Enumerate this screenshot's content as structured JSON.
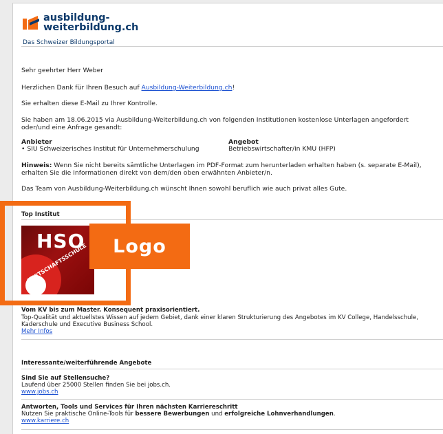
{
  "brand": {
    "line1": "ausbildung-",
    "line2": "weiterbildung.ch",
    "tagline": "Das Schweizer Bildungsportal",
    "colors": {
      "orange": "#f36b13",
      "navy": "#0d3a6b",
      "link": "#1a4fd0"
    }
  },
  "mail": {
    "salutation": "Sehr geehrter Herr Weber",
    "thanks_pre": "Herzlichen Dank für Ihren Besuch auf ",
    "thanks_link": "Ausbildung-Weiterbildung.ch",
    "thanks_post": "!",
    "control": "Sie erhalten diese E-Mail zu Ihrer Kontrolle.",
    "intro_line1": "Sie haben am 18.06.2015 via Ausbildung-Weiterbildung.ch von folgenden Institutionen kostenlose Unterlagen angefordert",
    "intro_line2": "oder/und eine Anfrage gesandt:",
    "anbieter_head": "Anbieter",
    "angebot_head": "Angebot",
    "anbieter_value": "• SIU Schweizerisches Institut für Unternehmerschulung",
    "angebot_value": "Betriebswirtschafter/in KMU (HFP)",
    "hinweis_label": "Hinweis:",
    "hinweis_line1": " Wenn Sie nicht bereits sämtliche Unterlagen im PDF-Format zum herunterladen erhalten haben (s. separate E-Mail),",
    "hinweis_line2": "erhalten Sie die Informationen direkt von dem/den oben erwähnten Anbieter/n.",
    "team": "Das Team von Ausbildung-Weiterbildung.ch wünscht Ihnen sowohl beruflich wie auch privat alles Gute."
  },
  "top_institut": {
    "heading": "Top Institut",
    "image_text": "HSO",
    "image_ring_text": "WIRTSCHAFTSSCHULE",
    "title": "Vom KV bis zum Master. Konsequent praxisorientiert.",
    "desc_line1": "Top-Qualität und aktuellstes Wissen auf jedem Gebiet, dank einer klaren Strukturierung des Angebotes im KV College, Handelsschule,",
    "desc_line2": "Kaderschule und Executive Business School.",
    "link": "Mehr Infos"
  },
  "overlay": {
    "label": "Logo"
  },
  "offers": {
    "heading": "Interessante/weiterführende Angebote",
    "items": [
      {
        "title": "Sind Sie auf Stellensuche?",
        "desc": "Laufend über 25000 Stellen finden Sie bei jobs.ch.",
        "link": "www.jobs.ch"
      },
      {
        "title": "Antworten, Tools und Services für Ihren nächsten Karriereschritt",
        "desc_pre": "Nutzen Sie praktische Online-Tools für ",
        "desc_b1": "bessere Bewerbungen",
        "desc_mid": " und ",
        "desc_b2": "erfolgreiche Lohnverhandlungen",
        "desc_post": ".",
        "link": "www.karriere.ch"
      }
    ]
  }
}
